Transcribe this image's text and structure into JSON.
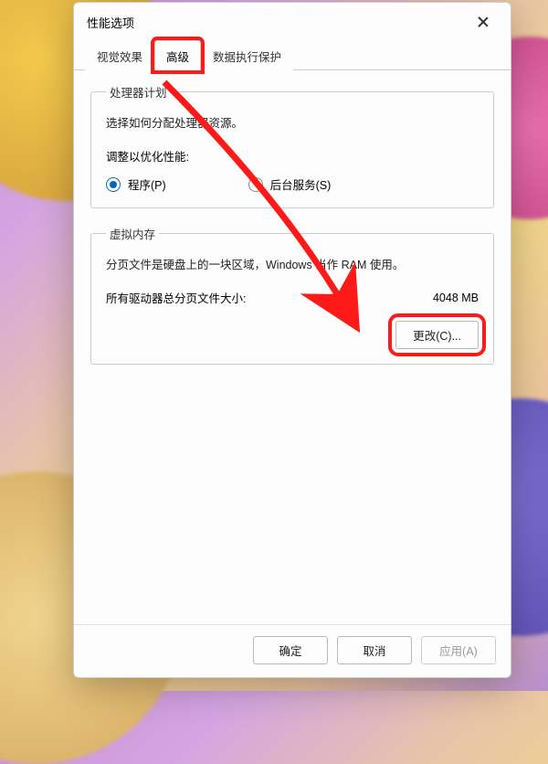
{
  "window": {
    "title": "性能选项"
  },
  "tabs": {
    "visual": "视觉效果",
    "advanced": "高级",
    "dep": "数据执行保护"
  },
  "processor": {
    "legend": "处理器计划",
    "desc": "选择如何分配处理器资源。",
    "subtitle": "调整以优化性能:",
    "programs": "程序(P)",
    "background": "后台服务(S)"
  },
  "vmem": {
    "legend": "虚拟内存",
    "desc": "分页文件是硬盘上的一块区域，Windows 当作 RAM 使用。",
    "total_label": "所有驱动器总分页文件大小:",
    "total_value": "4048 MB",
    "change_btn": "更改(C)..."
  },
  "buttons": {
    "ok": "确定",
    "cancel": "取消",
    "apply": "应用(A)"
  },
  "annotations": {
    "highlight_tab": "advanced",
    "highlight_button": "change",
    "arrow_color": "#ff1a1a"
  }
}
